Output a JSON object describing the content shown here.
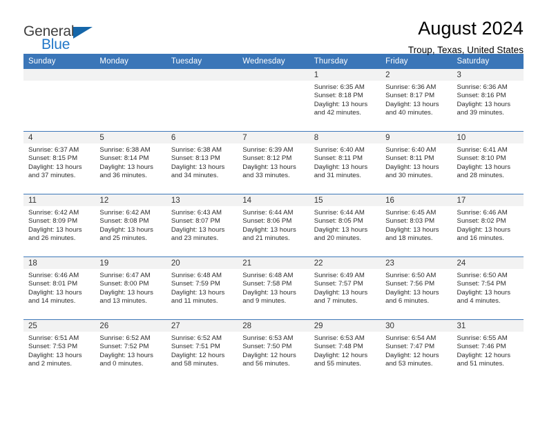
{
  "brand": {
    "name_top": "General",
    "name_bottom": "Blue",
    "accent_color": "#2277c8",
    "triangle_color": "#1566a9",
    "logo_icon": "general-blue-triangle-logo"
  },
  "header": {
    "title": "August 2024",
    "subtitle": "Troup, Texas, United States"
  },
  "theme": {
    "header_row_bg": "#3b76b8",
    "header_row_text": "#ffffff",
    "daynum_band_bg": "#f2f2f2",
    "cell_bg": "#ffffff",
    "row_divider": "#3b76b8"
  },
  "weekday_headers": [
    "Sunday",
    "Monday",
    "Tuesday",
    "Wednesday",
    "Thursday",
    "Friday",
    "Saturday"
  ],
  "labels": {
    "sunrise_prefix": "Sunrise:",
    "sunset_prefix": "Sunset:",
    "daylight_prefix": "Daylight:"
  },
  "weeks": [
    [
      {
        "day": "",
        "sunrise": "",
        "sunset": "",
        "daylight": "",
        "empty": true
      },
      {
        "day": "",
        "sunrise": "",
        "sunset": "",
        "daylight": "",
        "empty": true
      },
      {
        "day": "",
        "sunrise": "",
        "sunset": "",
        "daylight": "",
        "empty": true
      },
      {
        "day": "",
        "sunrise": "",
        "sunset": "",
        "daylight": "",
        "empty": true
      },
      {
        "day": "1",
        "sunrise": "Sunrise: 6:35 AM",
        "sunset": "Sunset: 8:18 PM",
        "daylight": "Daylight: 13 hours and 42 minutes."
      },
      {
        "day": "2",
        "sunrise": "Sunrise: 6:36 AM",
        "sunset": "Sunset: 8:17 PM",
        "daylight": "Daylight: 13 hours and 40 minutes."
      },
      {
        "day": "3",
        "sunrise": "Sunrise: 6:36 AM",
        "sunset": "Sunset: 8:16 PM",
        "daylight": "Daylight: 13 hours and 39 minutes."
      }
    ],
    [
      {
        "day": "4",
        "sunrise": "Sunrise: 6:37 AM",
        "sunset": "Sunset: 8:15 PM",
        "daylight": "Daylight: 13 hours and 37 minutes."
      },
      {
        "day": "5",
        "sunrise": "Sunrise: 6:38 AM",
        "sunset": "Sunset: 8:14 PM",
        "daylight": "Daylight: 13 hours and 36 minutes."
      },
      {
        "day": "6",
        "sunrise": "Sunrise: 6:38 AM",
        "sunset": "Sunset: 8:13 PM",
        "daylight": "Daylight: 13 hours and 34 minutes."
      },
      {
        "day": "7",
        "sunrise": "Sunrise: 6:39 AM",
        "sunset": "Sunset: 8:12 PM",
        "daylight": "Daylight: 13 hours and 33 minutes."
      },
      {
        "day": "8",
        "sunrise": "Sunrise: 6:40 AM",
        "sunset": "Sunset: 8:11 PM",
        "daylight": "Daylight: 13 hours and 31 minutes."
      },
      {
        "day": "9",
        "sunrise": "Sunrise: 6:40 AM",
        "sunset": "Sunset: 8:11 PM",
        "daylight": "Daylight: 13 hours and 30 minutes."
      },
      {
        "day": "10",
        "sunrise": "Sunrise: 6:41 AM",
        "sunset": "Sunset: 8:10 PM",
        "daylight": "Daylight: 13 hours and 28 minutes."
      }
    ],
    [
      {
        "day": "11",
        "sunrise": "Sunrise: 6:42 AM",
        "sunset": "Sunset: 8:09 PM",
        "daylight": "Daylight: 13 hours and 26 minutes."
      },
      {
        "day": "12",
        "sunrise": "Sunrise: 6:42 AM",
        "sunset": "Sunset: 8:08 PM",
        "daylight": "Daylight: 13 hours and 25 minutes."
      },
      {
        "day": "13",
        "sunrise": "Sunrise: 6:43 AM",
        "sunset": "Sunset: 8:07 PM",
        "daylight": "Daylight: 13 hours and 23 minutes."
      },
      {
        "day": "14",
        "sunrise": "Sunrise: 6:44 AM",
        "sunset": "Sunset: 8:06 PM",
        "daylight": "Daylight: 13 hours and 21 minutes."
      },
      {
        "day": "15",
        "sunrise": "Sunrise: 6:44 AM",
        "sunset": "Sunset: 8:05 PM",
        "daylight": "Daylight: 13 hours and 20 minutes."
      },
      {
        "day": "16",
        "sunrise": "Sunrise: 6:45 AM",
        "sunset": "Sunset: 8:03 PM",
        "daylight": "Daylight: 13 hours and 18 minutes."
      },
      {
        "day": "17",
        "sunrise": "Sunrise: 6:46 AM",
        "sunset": "Sunset: 8:02 PM",
        "daylight": "Daylight: 13 hours and 16 minutes."
      }
    ],
    [
      {
        "day": "18",
        "sunrise": "Sunrise: 6:46 AM",
        "sunset": "Sunset: 8:01 PM",
        "daylight": "Daylight: 13 hours and 14 minutes."
      },
      {
        "day": "19",
        "sunrise": "Sunrise: 6:47 AM",
        "sunset": "Sunset: 8:00 PM",
        "daylight": "Daylight: 13 hours and 13 minutes."
      },
      {
        "day": "20",
        "sunrise": "Sunrise: 6:48 AM",
        "sunset": "Sunset: 7:59 PM",
        "daylight": "Daylight: 13 hours and 11 minutes."
      },
      {
        "day": "21",
        "sunrise": "Sunrise: 6:48 AM",
        "sunset": "Sunset: 7:58 PM",
        "daylight": "Daylight: 13 hours and 9 minutes."
      },
      {
        "day": "22",
        "sunrise": "Sunrise: 6:49 AM",
        "sunset": "Sunset: 7:57 PM",
        "daylight": "Daylight: 13 hours and 7 minutes."
      },
      {
        "day": "23",
        "sunrise": "Sunrise: 6:50 AM",
        "sunset": "Sunset: 7:56 PM",
        "daylight": "Daylight: 13 hours and 6 minutes."
      },
      {
        "day": "24",
        "sunrise": "Sunrise: 6:50 AM",
        "sunset": "Sunset: 7:54 PM",
        "daylight": "Daylight: 13 hours and 4 minutes."
      }
    ],
    [
      {
        "day": "25",
        "sunrise": "Sunrise: 6:51 AM",
        "sunset": "Sunset: 7:53 PM",
        "daylight": "Daylight: 13 hours and 2 minutes."
      },
      {
        "day": "26",
        "sunrise": "Sunrise: 6:52 AM",
        "sunset": "Sunset: 7:52 PM",
        "daylight": "Daylight: 13 hours and 0 minutes."
      },
      {
        "day": "27",
        "sunrise": "Sunrise: 6:52 AM",
        "sunset": "Sunset: 7:51 PM",
        "daylight": "Daylight: 12 hours and 58 minutes."
      },
      {
        "day": "28",
        "sunrise": "Sunrise: 6:53 AM",
        "sunset": "Sunset: 7:50 PM",
        "daylight": "Daylight: 12 hours and 56 minutes."
      },
      {
        "day": "29",
        "sunrise": "Sunrise: 6:53 AM",
        "sunset": "Sunset: 7:48 PM",
        "daylight": "Daylight: 12 hours and 55 minutes."
      },
      {
        "day": "30",
        "sunrise": "Sunrise: 6:54 AM",
        "sunset": "Sunset: 7:47 PM",
        "daylight": "Daylight: 12 hours and 53 minutes."
      },
      {
        "day": "31",
        "sunrise": "Sunrise: 6:55 AM",
        "sunset": "Sunset: 7:46 PM",
        "daylight": "Daylight: 12 hours and 51 minutes."
      }
    ]
  ]
}
